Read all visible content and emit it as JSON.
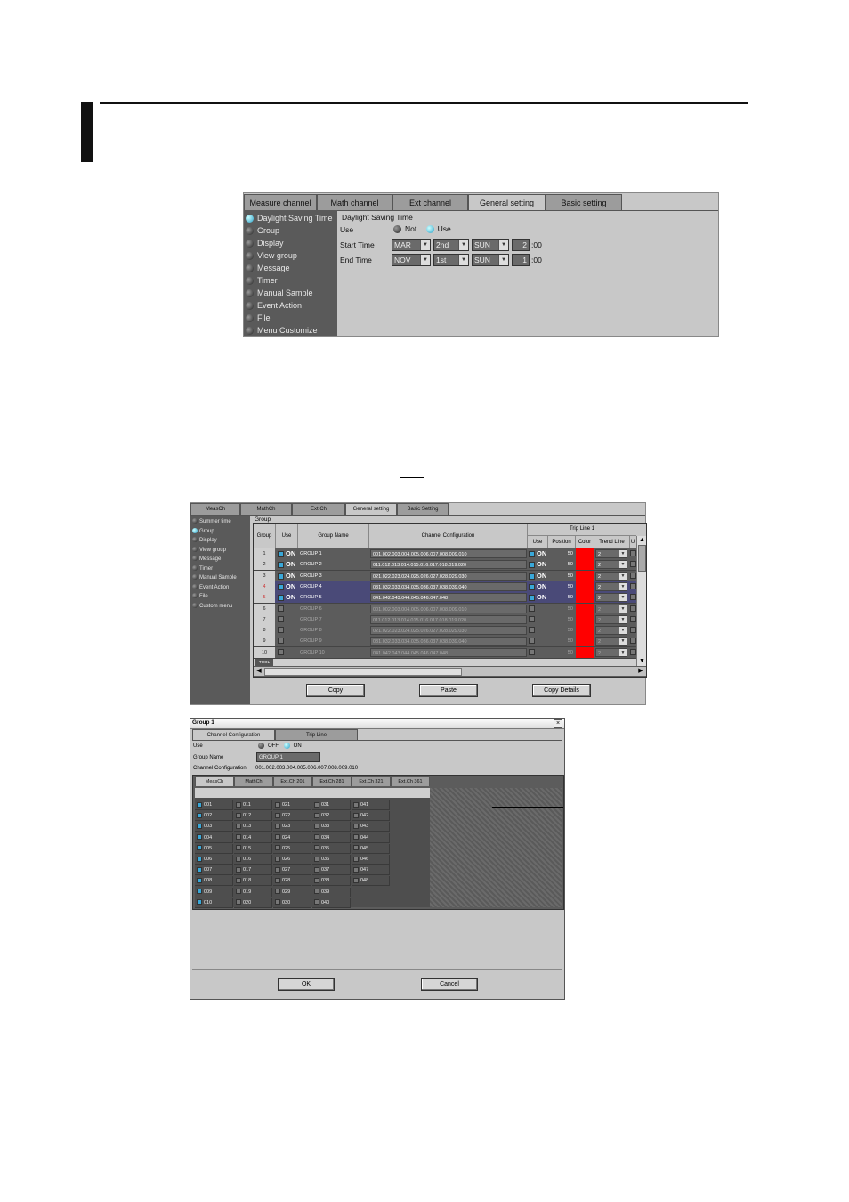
{
  "screen1": {
    "tabs": [
      "Measure channel",
      "Math channel",
      "Ext channel",
      "General setting",
      "Basic setting"
    ],
    "active_tab": 3,
    "menu": [
      "Daylight Saving Time",
      "Group",
      "Display",
      "View group",
      "Message",
      "Timer",
      "Manual Sample",
      "Event Action",
      "File",
      "Menu Customize"
    ],
    "panel_title": "Daylight Saving Time",
    "use_label": "Use",
    "not_label": "Not",
    "use_option": "Use",
    "start_label": "Start Time",
    "end_label": "End Time",
    "start": {
      "month": "MAR",
      "week": "2nd",
      "day": "SUN",
      "hour": "2",
      "min": ":00"
    },
    "end": {
      "month": "NOV",
      "week": "1st",
      "day": "SUN",
      "hour": "1",
      "min": ":00"
    }
  },
  "screen2": {
    "tabs": [
      "MeasCh",
      "MathCh",
      "Ext.Ch",
      "General setting",
      "Basic Setting"
    ],
    "active_tab": 3,
    "menu": [
      "Summer time",
      "Group",
      "Display",
      "View group",
      "Message",
      "Timer",
      "Manual Sample",
      "Event Action",
      "File",
      "Custom menu"
    ],
    "menu_selected": 1,
    "section_title": "Group",
    "headers": {
      "group": "Group",
      "use": "Use",
      "name": "Group Name",
      "config": "Channel Configuration",
      "trip": "Trip Line 1",
      "t_use": "Use",
      "t_pos": "Position",
      "t_color": "Color",
      "t_trend": "Trend Line",
      "t_u": "U"
    },
    "rows": [
      {
        "no": "1",
        "state": "ON",
        "name": "GROUP 1",
        "config": "001.002.003.004.005.006.007.008.009.010",
        "t_state": "ON",
        "pos": "50",
        "trend": "2"
      },
      {
        "no": "2",
        "state": "ON",
        "name": "GROUP 2",
        "config": "011.012.013.014.015.016.017.018.019.020",
        "t_state": "ON",
        "pos": "50",
        "trend": "2"
      },
      {
        "no": "3",
        "state": "ON",
        "name": "GROUP 3",
        "config": "021.022.023.024.025.026.027.028.029.030",
        "t_state": "ON",
        "pos": "50",
        "trend": "2"
      },
      {
        "no": "4",
        "state": "ON",
        "name": "GROUP 4",
        "config": "031.032.033.034.035.036.037.038.039.040",
        "t_state": "ON",
        "pos": "50",
        "trend": "2"
      },
      {
        "no": "5",
        "state": "ON",
        "name": "GROUP 5",
        "config": "041.042.043.044.045.046.047.048",
        "t_state": "ON",
        "pos": "50",
        "trend": "2"
      },
      {
        "no": "6",
        "state": "OFF",
        "name": "GROUP 6",
        "config": "001.002.003.004.005.006.007.008.009.010",
        "t_state": "OFF",
        "pos": "50",
        "trend": "2"
      },
      {
        "no": "7",
        "state": "OFF",
        "name": "GROUP 7",
        "config": "011.012.013.014.015.016.017.018.019.020",
        "t_state": "OFF",
        "pos": "50",
        "trend": "2"
      },
      {
        "no": "8",
        "state": "OFF",
        "name": "GROUP 8",
        "config": "021.022.023.024.025.026.027.028.029.030",
        "t_state": "OFF",
        "pos": "50",
        "trend": "2"
      },
      {
        "no": "9",
        "state": "OFF",
        "name": "GROUP 9",
        "config": "031.032.033.034.035.036.037.038.039.040",
        "t_state": "OFF",
        "pos": "50",
        "trend": "2"
      },
      {
        "no": "10",
        "state": "OFF",
        "name": "GROUP 10",
        "config": "041.042.043.044.045.046.047.048",
        "t_state": "OFF",
        "pos": "50",
        "trend": "2"
      }
    ],
    "highlight_rows": [
      3,
      4
    ],
    "footer_cell": "TOOL",
    "buttons": [
      "Copy",
      "Paste",
      "Copy Details"
    ]
  },
  "dialog": {
    "title": "Group 1",
    "tabs": [
      "Channel Configuration",
      "Trip Line"
    ],
    "use_label": "Use",
    "off_label": "OFF",
    "on_label": "ON",
    "name_label": "Group Name",
    "name_value": "GROUP 1",
    "config_label": "Channel Configuration",
    "config_value": "001.002.003.004.005.006.007.008.009.010",
    "subtabs": [
      "MeasCh",
      "MathCh",
      "Ext.Ch 201",
      "Ext.Ch 281",
      "Ext.Ch 321",
      "Ext.Ch 361"
    ],
    "columns": [
      [
        "001",
        "002",
        "003",
        "004",
        "005",
        "006",
        "007",
        "008",
        "009",
        "010"
      ],
      [
        "011",
        "012",
        "013",
        "014",
        "015",
        "016",
        "017",
        "018",
        "019",
        "020"
      ],
      [
        "021",
        "022",
        "023",
        "024",
        "025",
        "026",
        "027",
        "028",
        "029",
        "030"
      ],
      [
        "031",
        "032",
        "033",
        "034",
        "035",
        "036",
        "037",
        "038",
        "039",
        "040"
      ],
      [
        "041",
        "042",
        "043",
        "044",
        "045",
        "046",
        "047",
        "048"
      ]
    ],
    "ok": "OK",
    "cancel": "Cancel",
    "accent": "#3aa8d8"
  }
}
